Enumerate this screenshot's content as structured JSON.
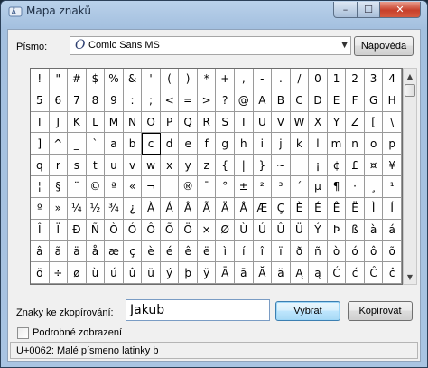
{
  "window": {
    "title": "Mapa znaků",
    "min": "–",
    "max": "☐",
    "close": "✕"
  },
  "font": {
    "label": "Písmo:",
    "selected": "Comic Sans MS",
    "icon_glyph": "O"
  },
  "help_button": "Nápověda",
  "grid": {
    "selected_index": 66,
    "chars": [
      "!",
      "\"",
      "#",
      "$",
      "%",
      "&",
      "'",
      "(",
      ")",
      "*",
      "+",
      ",",
      "-",
      ".",
      "/",
      "0",
      "1",
      "2",
      "3",
      "4",
      "5",
      "6",
      "7",
      "8",
      "9",
      ":",
      ";",
      "<",
      "=",
      ">",
      "?",
      "@",
      "A",
      "B",
      "C",
      "D",
      "E",
      "F",
      "G",
      "H",
      "I",
      "J",
      "K",
      "L",
      "M",
      "N",
      "O",
      "P",
      "Q",
      "R",
      "S",
      "T",
      "U",
      "V",
      "W",
      "X",
      "Y",
      "Z",
      "[",
      "\\",
      "]",
      "^",
      "_",
      "`",
      "a",
      "b",
      "c",
      "d",
      "e",
      "f",
      "g",
      "h",
      "i",
      "j",
      "k",
      "l",
      "m",
      "n",
      "o",
      "p",
      "q",
      "r",
      "s",
      "t",
      "u",
      "v",
      "w",
      "x",
      "y",
      "z",
      "{",
      "|",
      "}",
      "~",
      " ",
      "¡",
      "¢",
      "£",
      "¤",
      "¥",
      "¦",
      "§",
      "¨",
      "©",
      "ª",
      "«",
      "¬",
      "­",
      "®",
      "¯",
      "°",
      "±",
      "²",
      "³",
      "´",
      "µ",
      "¶",
      "·",
      "¸",
      "¹",
      "º",
      "»",
      "¼",
      "½",
      "¾",
      "¿",
      "À",
      "Á",
      "Â",
      "Ã",
      "Ä",
      "Å",
      "Æ",
      "Ç",
      "È",
      "É",
      "Ê",
      "Ë",
      "Ì",
      "Í",
      "Î",
      "Ï",
      "Ð",
      "Ñ",
      "Ò",
      "Ó",
      "Ô",
      "Õ",
      "Ö",
      "×",
      "Ø",
      "Ù",
      "Ú",
      "Û",
      "Ü",
      "Ý",
      "Þ",
      "ß",
      "à",
      "á",
      "â",
      "ã",
      "ä",
      "å",
      "æ",
      "ç",
      "è",
      "é",
      "ê",
      "ë",
      "ì",
      "í",
      "î",
      "ï",
      "ð",
      "ñ",
      "ò",
      "ó",
      "ô",
      "õ",
      "ö",
      "÷",
      "ø",
      "ù",
      "ú",
      "û",
      "ü",
      "ý",
      "þ",
      "ÿ",
      "Ā",
      "ā",
      "Ă",
      "ă",
      "Ą",
      "ą",
      "Ć",
      "ć",
      "Ĉ",
      "ĉ"
    ]
  },
  "copy": {
    "label": "Znaky ke zkopírování:",
    "value": "Jakub",
    "select_button": "Vybrat",
    "copy_button": "Kopírovat"
  },
  "advanced": {
    "label": "Podrobné zobrazení",
    "checked": false
  },
  "status": "U+0062: Malé písmeno latinky b"
}
